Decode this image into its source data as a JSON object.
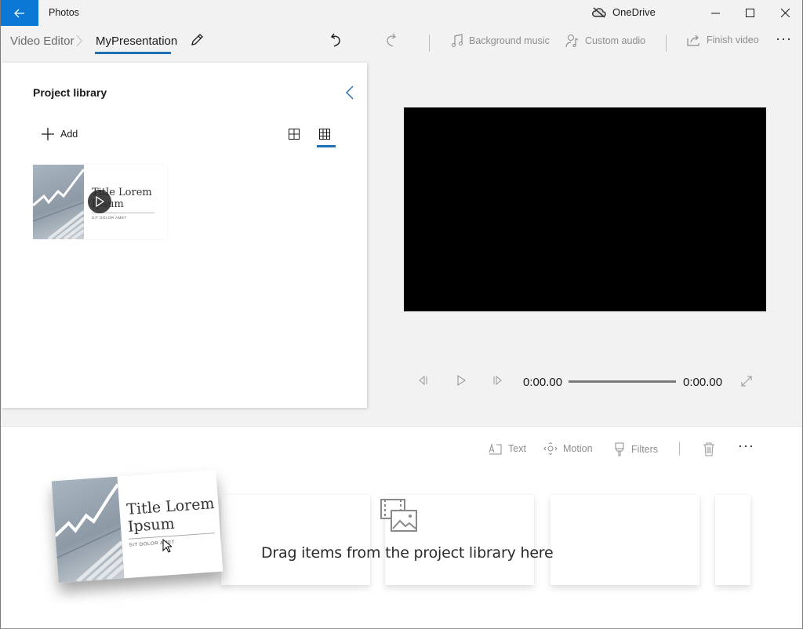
{
  "titlebar": {
    "app_title": "Photos",
    "back_icon": "arrow-left-icon",
    "cloud_label": "OneDrive",
    "cloud_icon": "cloud-off-icon",
    "accent": "#0a78d4"
  },
  "breadcrumb": {
    "root": "Video Editor",
    "current": "MyPresentation"
  },
  "toolbar": {
    "undo_icon": "undo-icon",
    "redo_icon": "redo-icon",
    "background_music": "Background music",
    "custom_audio": "Custom audio",
    "finish_video": "Finish video",
    "more": "···"
  },
  "library": {
    "title": "Project library",
    "add_label": "Add",
    "items": [
      {
        "slide_title": "Title Lorem Ipsum",
        "slide_title_line1": "Title Lorem",
        "slide_title_line2": "Ipsum",
        "slide_subtitle": "SIT DOLOR AMET"
      }
    ]
  },
  "player": {
    "current_time": "0:00.00",
    "total_time": "0:00.00",
    "progress": 0
  },
  "storyboard": {
    "text_label": "Text",
    "motion_label": "Motion",
    "filters_label": "Filters",
    "more": "···",
    "empty_message": "Drag items from the project library here",
    "dragging_item": {
      "title_line1": "Title Lorem",
      "title_line2": "Ipsum",
      "subtitle": "SIT DOLOR AMET"
    }
  }
}
